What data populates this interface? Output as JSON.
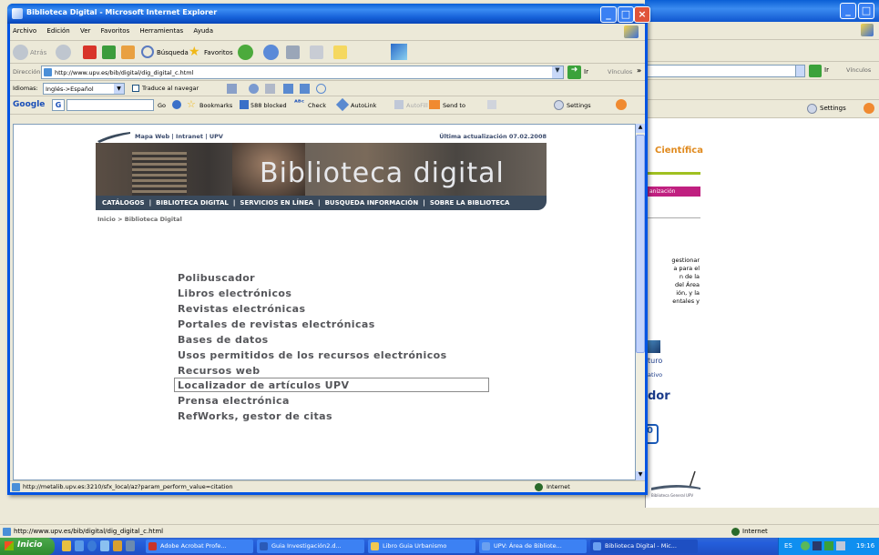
{
  "front_window": {
    "title": "Biblioteca Digital - Microsoft Internet Explorer",
    "menu": [
      "Archivo",
      "Edición",
      "Ver",
      "Favoritos",
      "Herramientas",
      "Ayuda"
    ],
    "toolbar": {
      "back": "Atrás",
      "search": "Búsqueda",
      "favorites": "Favoritos"
    },
    "address": {
      "label": "Dirección",
      "url": "http://www.upv.es/bib/digital/dig_digital_c.html",
      "go": "Ir",
      "links": "Vínculos"
    },
    "translate": {
      "label": "Idiomas:",
      "select": "Inglés->Español",
      "checkbox": "Traduce al navegar"
    },
    "google": {
      "label": "Google",
      "go": "Go",
      "bookmarks": "Bookmarks",
      "blocked": "588 blocked",
      "check": "Check",
      "autolink": "AutoLink",
      "autofill": "AutoFill",
      "sendto": "Send to",
      "settings": "Settings"
    },
    "page": {
      "top_links": "Mapa Web | Intranet | UPV",
      "updated": "Última actualización 07.02.2008",
      "banner_title": "Biblioteca digital",
      "nav": [
        "CATÁLOGOS",
        "BIBLIOTECA DIGITAL",
        "SERVICIOS EN LÍNEA",
        "BUSQUEDA INFORMACIÓN",
        "SOBRE LA BIBLIOTECA"
      ],
      "breadcrumb": "Inicio > Biblioteca Digital",
      "links": [
        "Polibuscador",
        "Libros electrónicos",
        "Revistas electrónicas",
        "Portales de revistas electrónicas",
        "Bases de datos",
        "Usos permitidos de los recursos electrónicos",
        "Recursos web",
        "Localizador de artículos UPV",
        "Prensa electrónica",
        "RefWorks, gestor de citas"
      ],
      "selected_index": 7
    },
    "status": {
      "url": "http://metalib.upv.es:3210/sfx_local/az?param_perform_value=citation",
      "zone": "Internet"
    }
  },
  "back_window": {
    "go": "Ir",
    "links": "Vínculos",
    "settings": "Settings",
    "heading": "Científica",
    "tab": "anización",
    "text": [
      "gestionar",
      "a para el",
      "n de la",
      "del Área",
      "ión, y la",
      "entales y"
    ],
    "side1": "turo",
    "side2": "ativo",
    "side3": "dor",
    "side4": "0",
    "logo": "Biblioteca General UPV",
    "status_url": "http://www.upv.es/bib/digital/dig_digital_c.html",
    "status_zone": "Internet"
  },
  "taskbar": {
    "start": "Inicio",
    "tasks": [
      "Adobe Acrobat Profe...",
      "Guia Investigación2.d...",
      "Libro Guia Urbanismo",
      "UPV: Área de Bibliote...",
      "Biblioteca Digital - Mic..."
    ],
    "lang": "ES",
    "clock": "19:16"
  },
  "colors": {
    "xp_blue": "#0054e3",
    "nav_bar": "#3a4a5c",
    "link_gray": "#55565a",
    "heading_orange": "#e08a1e"
  }
}
